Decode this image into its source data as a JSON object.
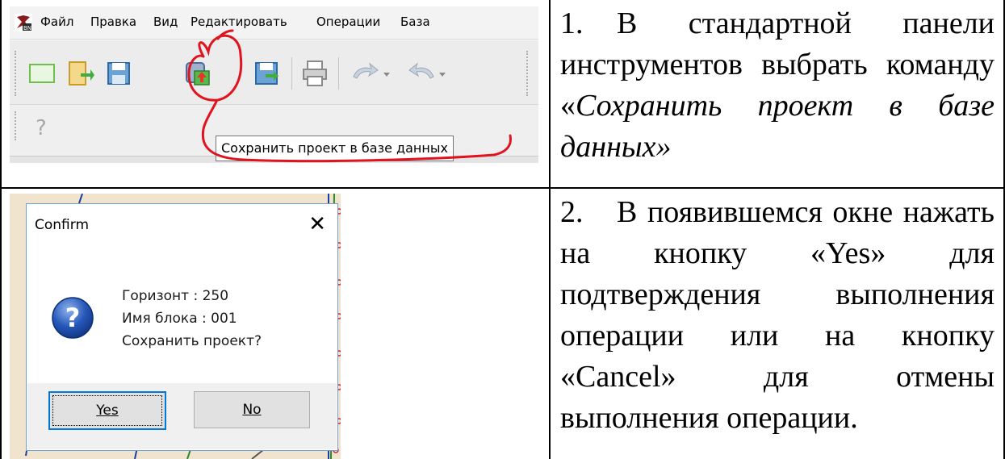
{
  "step1": {
    "number": "1.",
    "text_before": "В стандартной панели инструментов выбрать команду «",
    "text_italic": "Сохранить проект в базе данных»",
    "screenshot": {
      "app_icon": "bn-app-icon",
      "menu_items": [
        "Файл",
        "Правка",
        "Вид",
        "Редактировать",
        "Операции",
        "База"
      ],
      "toolbar_icons": [
        "new-document-icon",
        "open-document-icon",
        "save-icon",
        "save-project-to-database-icon",
        "save-as-icon",
        "print-icon",
        "undo-icon",
        "redo-icon"
      ],
      "help_glyph": "?",
      "tooltip": "Сохранить проект в базе данных",
      "highlight_color": "#e0141e"
    }
  },
  "step2": {
    "number": "2.",
    "text": "В появившемся окне нажать на кнопку «Yes» для подтверждения выполнения операции или на кнопку «Cancel» для отмены выполнения операции.",
    "dialog": {
      "title": "Confirm",
      "close_glyph": "✕",
      "icon": "question-icon",
      "lines": [
        "Горизонт : 250",
        "Имя блока : 001",
        "Сохранить проект?"
      ],
      "yes_label": "Yes",
      "no_label": "No"
    }
  }
}
